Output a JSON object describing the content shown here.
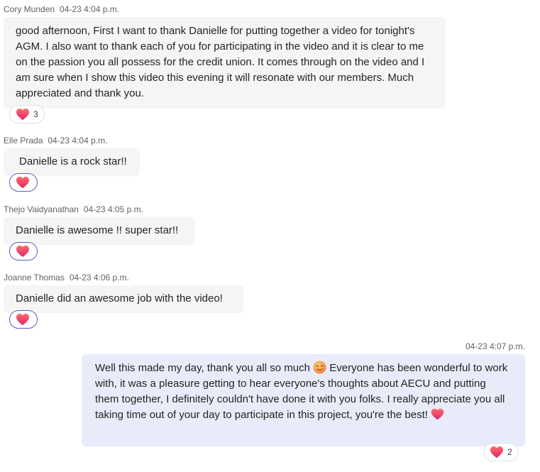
{
  "messages": [
    {
      "author": "Cory Munden",
      "time": "04-23 4:04 p.m.",
      "text": "good afternoon, First I want to thank Danielle for putting together a video for tonight's AGM. I also want to thank each of you for participating in the video and it is clear to me on the passion you all possess for the credit union. It comes through on the video and I am sure when I show this video this evening it will resonate with our members. Much appreciated and thank you.",
      "reaction": {
        "icon": "heart-icon",
        "count": "3"
      }
    },
    {
      "author": "Elle Prada",
      "time": "04-23 4:04 p.m.",
      "text": "Danielle is a rock star!!",
      "reaction": {
        "icon": "heart-icon"
      }
    },
    {
      "author": "Thejo Vaidyanathan",
      "time": "04-23 4:05 p.m.",
      "text": "Danielle is awesome !! super star!!",
      "reaction": {
        "icon": "heart-icon"
      }
    },
    {
      "author": "Joanne Thomas",
      "time": "04-23 4:06 p.m.",
      "text": "Danielle did an awesome job with the video!",
      "reaction": {
        "icon": "heart-icon"
      }
    },
    {
      "time": "04-23 4:07 p.m.",
      "text_part1": "Well this made my day, thank you all so much",
      "text_part2": " Everyone has been wonderful to work with, it was a pleasure getting to hear everyone's thoughts about AECU and putting them together, I definitely couldn't have done it with you folks. I really appreciate you all taking time out of your day to participate in this project, you're the best! ",
      "reaction": {
        "icon": "heart-icon",
        "count": "2"
      }
    }
  ],
  "colors": {
    "bubble_other": "#f5f5f5",
    "bubble_self": "#e8ebfa",
    "my_reaction_border": "#5b5fc7",
    "heart": "#f03a5f"
  }
}
